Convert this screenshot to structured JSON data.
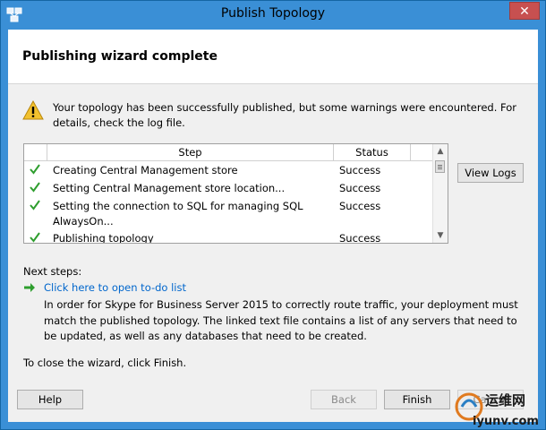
{
  "window": {
    "title": "Publish Topology",
    "close_glyph": "✕"
  },
  "header": {
    "heading": "Publishing wizard complete"
  },
  "warning": {
    "icon": "warning-triangle-icon",
    "message": "Your topology has been successfully published, but some warnings were encountered. For details, check the log file."
  },
  "grid": {
    "columns": {
      "step": "Step",
      "status": "Status"
    },
    "rows": [
      {
        "step": "Creating Central Management store",
        "status": "Success"
      },
      {
        "step": "Setting Central Management store location...",
        "status": "Success"
      },
      {
        "step": "Setting the connection to SQL for managing SQL AlwaysOn...",
        "status": "Success"
      },
      {
        "step": "Publishing topology",
        "status": "Success"
      }
    ],
    "check_color": "#2e9e2e"
  },
  "buttons": {
    "view_logs": "View Logs",
    "help": "Help",
    "back": "Back",
    "finish": "Finish",
    "cancel": "Cancel"
  },
  "next_steps": {
    "label": "Next steps:",
    "link_text": "Click here to open to-do list",
    "description": "In order for Skype for Business Server 2015 to correctly route traffic, your deployment must match the published topology. The linked text file contains a list of any servers that need to be updated, as well as any databases that need to be created."
  },
  "close_hint": "To close the wizard, click Finish.",
  "watermark": {
    "text_cn": "运维网",
    "text_url": "iyunv.com"
  }
}
